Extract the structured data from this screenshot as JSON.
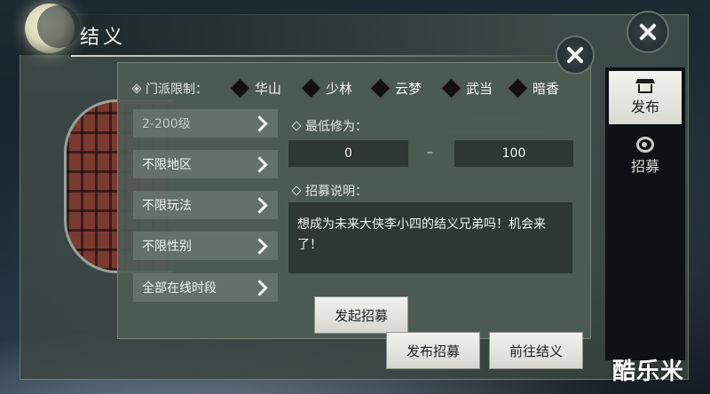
{
  "window": {
    "title": "结义"
  },
  "sect_filter": {
    "label": "门派限制：",
    "options": [
      {
        "label": "华山"
      },
      {
        "label": "少林"
      },
      {
        "label": "云梦"
      },
      {
        "label": "武当"
      },
      {
        "label": "暗香"
      }
    ]
  },
  "filters": [
    {
      "label": "2-200级"
    },
    {
      "label": "不限地区"
    },
    {
      "label": "不限玩法"
    },
    {
      "label": "不限性别"
    },
    {
      "label": "全部在线时段"
    }
  ],
  "cultivation": {
    "label": "最低修为：",
    "min": "0",
    "separator": "–",
    "max": "100"
  },
  "description": {
    "label": "招募说明：",
    "text": "想成为未来大侠李小四的结义兄弟吗！机会来了！"
  },
  "buttons": {
    "launch": "发起招募",
    "publish": "发布招募",
    "goto": "前往结义"
  },
  "side_tabs": [
    {
      "label": "发布",
      "icon": "house-icon",
      "selected": true
    },
    {
      "label": "招募",
      "icon": "swirl-icon",
      "selected": false
    }
  ],
  "watermark": "酷乐米"
}
